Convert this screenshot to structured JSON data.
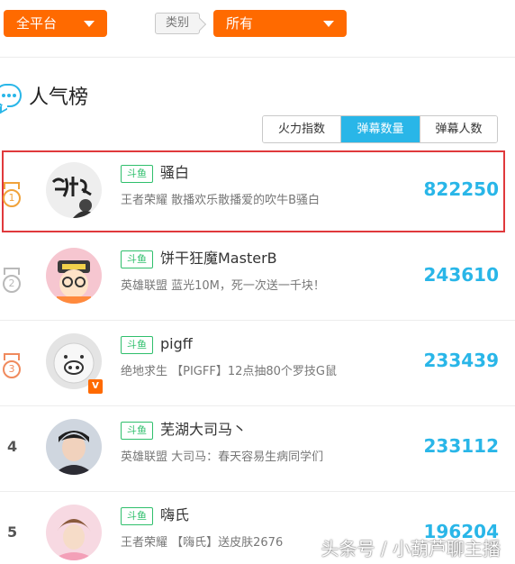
{
  "filters": {
    "platform": "全平台",
    "category_label": "类别",
    "category": "所有"
  },
  "section": {
    "title": "人气榜"
  },
  "tabs": [
    {
      "label": "火力指数",
      "active": false
    },
    {
      "label": "弹幕数量",
      "active": true
    },
    {
      "label": "弹幕人数",
      "active": false
    }
  ],
  "rows": [
    {
      "rank": "1",
      "platform_tag": "斗鱼",
      "name": "骚白",
      "desc": "王者荣耀 散播欢乐散播爱的吹牛B骚白",
      "count": "822250"
    },
    {
      "rank": "2",
      "platform_tag": "斗鱼",
      "name": "饼干狂魔MasterB",
      "desc": "英雄联盟 蓝光10M，死一次送一千块！",
      "count": "243610"
    },
    {
      "rank": "3",
      "platform_tag": "斗鱼",
      "name": "pigff",
      "desc": "绝地求生 【PIGFF】12点抽80个罗技G鼠",
      "count": "233439",
      "verified_badge": "V"
    },
    {
      "rank": "4",
      "platform_tag": "斗鱼",
      "name": "芜湖大司马丶",
      "desc": "英雄联盟 大司马：春天容易生病同学们",
      "count": "233112"
    },
    {
      "rank": "5",
      "platform_tag": "斗鱼",
      "name": "嗨氏",
      "desc": "王者荣耀 【嗨氏】送皮肤2676",
      "count": "196204"
    }
  ],
  "watermark": "头条号 / 小葫芦聊主播",
  "colors": {
    "accent_orange": "#ff6a00",
    "accent_blue": "#29b6e8",
    "tag_green": "#2fbf6c",
    "highlight_red": "#e0393c"
  }
}
